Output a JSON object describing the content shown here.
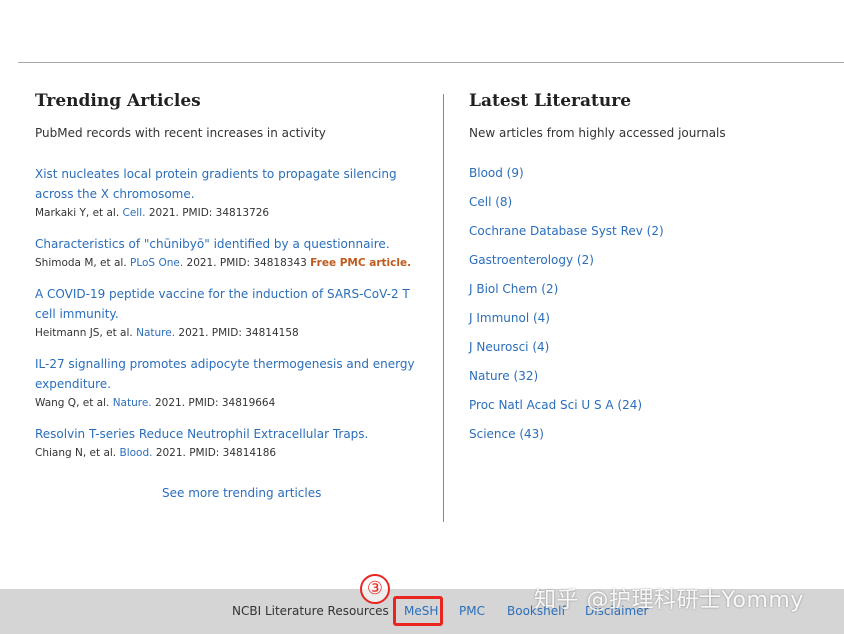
{
  "trending": {
    "title": "Trending Articles",
    "subtitle": "PubMed records with recent increases in activity",
    "articles": [
      {
        "title": "Xist nucleates local protein gradients to propagate silencing across the X chromosome.",
        "authors": "Markaki Y, et al.",
        "journal": "Cell.",
        "details": "2021. PMID: 34813726",
        "free": ""
      },
      {
        "title": "Characteristics of \"chūnibyō\" identified by a questionnaire.",
        "authors": "Shimoda M, et al.",
        "journal": "PLoS One.",
        "details": "2021. PMID: 34818343",
        "free": "Free PMC article."
      },
      {
        "title": "A COVID-19 peptide vaccine for the induction of SARS-CoV-2 T cell immunity.",
        "authors": "Heitmann JS, et al.",
        "journal": "Nature.",
        "details": "2021. PMID: 34814158",
        "free": ""
      },
      {
        "title": "IL-27 signalling promotes adipocyte thermogenesis and energy expenditure.",
        "authors": "Wang Q, et al.",
        "journal": "Nature.",
        "details": "2021. PMID: 34819664",
        "free": ""
      },
      {
        "title": "Resolvin T-series Reduce Neutrophil Extracellular Traps.",
        "authors": "Chiang N, et al.",
        "journal": "Blood.",
        "details": "2021. PMID: 34814186",
        "free": ""
      }
    ],
    "see_more": "See more trending articles"
  },
  "latest": {
    "title": "Latest Literature",
    "subtitle": "New articles from highly accessed journals",
    "journals": [
      "Blood (9)",
      "Cell (8)",
      "Cochrane Database Syst Rev (2)",
      "Gastroenterology (2)",
      "J Biol Chem (2)",
      "J Immunol (4)",
      "J Neurosci (4)",
      "Nature (32)",
      "Proc Natl Acad Sci U S A (24)",
      "Science (43)"
    ]
  },
  "footer": {
    "label": "NCBI Literature Resources",
    "links": [
      "MeSH",
      "PMC",
      "Bookshelf",
      "Disclaimer"
    ]
  },
  "annotation": {
    "number": "③"
  },
  "watermark": "知乎 @护理科研士Yommy",
  "colors": {
    "link": "#2a6ebb",
    "free_article": "#c05a1c",
    "annotation": "#e8261f",
    "footer_bg": "#d5d5d5"
  }
}
